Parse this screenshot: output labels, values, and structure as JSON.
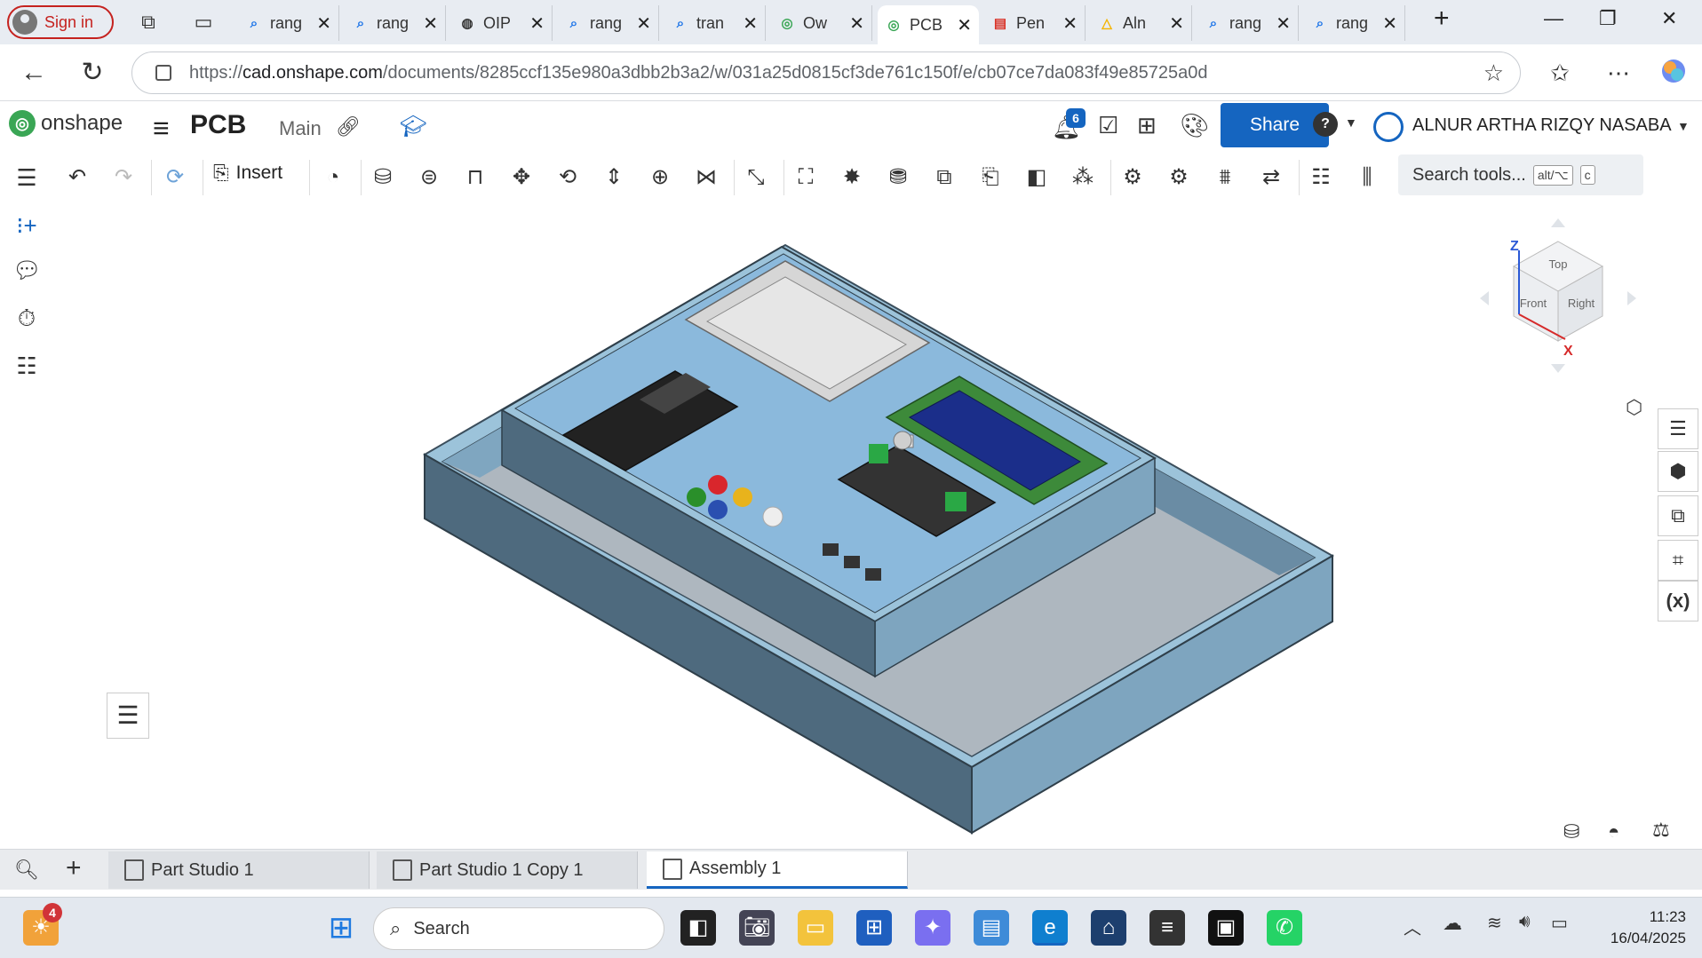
{
  "browser": {
    "signin_label": "Sign in",
    "tabs": [
      {
        "title": "rang",
        "favicon": "search-favicon"
      },
      {
        "title": "rang",
        "favicon": "search-favicon"
      },
      {
        "title": "OIP",
        "favicon": "globe-favicon"
      },
      {
        "title": "rang",
        "favicon": "search-favicon"
      },
      {
        "title": "tran",
        "favicon": "search-favicon"
      },
      {
        "title": "Ow",
        "favicon": "onshape-favicon"
      },
      {
        "title": "PCB",
        "favicon": "onshape-favicon",
        "active": true
      },
      {
        "title": "Pen",
        "favicon": "pdf-favicon"
      },
      {
        "title": "Aln",
        "favicon": "drive-favicon"
      },
      {
        "title": "rang",
        "favicon": "search-favicon"
      },
      {
        "title": "rang",
        "favicon": "search-favicon"
      }
    ],
    "url_prefix": "https://",
    "url_host": "cad.onshape.com",
    "url_path": "/documents/8285ccf135e980a3dbb2b3a2/w/031a25d0815cf3de761c150f/e/cb07ce7da083f49e85725a0d"
  },
  "onshape": {
    "logo_text": "onshape",
    "document_name": "PCB",
    "branch": "Main",
    "notification_count": "6",
    "share_label": "Share",
    "user_name": "ALNUR ARTHA RIZQY NASABA",
    "insert_label": "Insert",
    "search_tools_placeholder": "Search tools...",
    "search_shortcut_1": "alt/⌥",
    "search_shortcut_2": "c",
    "viewcube": {
      "top": "Top",
      "front": "Front",
      "right": "Right",
      "axis_x": "X",
      "axis_z": "Z"
    },
    "bottom_tabs": [
      {
        "label": "Part Studio 1"
      },
      {
        "label": "Part Studio 1 Copy 1"
      },
      {
        "label": "Assembly 1",
        "active": true
      }
    ]
  },
  "taskbar": {
    "search_placeholder": "Search",
    "notification_count": "4",
    "time": "11:23",
    "date": "16/04/2025"
  },
  "colors": {
    "accent": "#1565c0",
    "enclosure": "#8cb3cc",
    "enclosure_dark": "#4e6a7e",
    "onshape_green": "#3aa655"
  }
}
